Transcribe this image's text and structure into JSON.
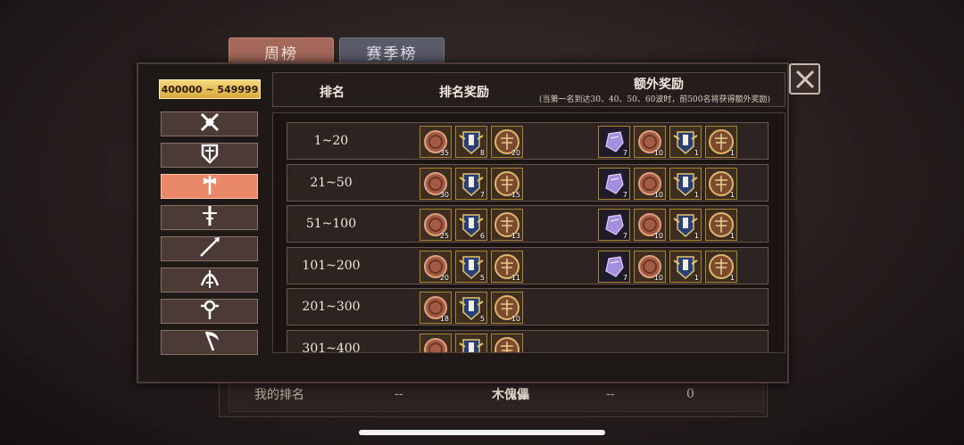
{
  "tabs": {
    "weekly": "周榜",
    "season": "赛季榜"
  },
  "score_range": "400000 ~ 549999",
  "weapons": [
    {
      "icon": "crossed-swords-icon",
      "active": false
    },
    {
      "icon": "shield-icon",
      "active": false
    },
    {
      "icon": "axe-icon",
      "active": true
    },
    {
      "icon": "greatsword-icon",
      "active": false
    },
    {
      "icon": "spear-icon",
      "active": false
    },
    {
      "icon": "bow-icon",
      "active": false
    },
    {
      "icon": "orb-staff-icon",
      "active": false
    },
    {
      "icon": "scythe-icon",
      "active": false
    }
  ],
  "header": {
    "rank": "排名",
    "rank_reward": "排名奖励",
    "extra_reward": "额外奖励",
    "extra_note": "(当第一名到达30、40、50、60波时，前500名将获得额外奖励)"
  },
  "rows": [
    {
      "rank": "1~20",
      "rewards": [
        35,
        8,
        20
      ],
      "extra": [
        7,
        10,
        1,
        1
      ]
    },
    {
      "rank": "21~50",
      "rewards": [
        30,
        7,
        15
      ],
      "extra": [
        7,
        10,
        1,
        1
      ]
    },
    {
      "rank": "51~100",
      "rewards": [
        25,
        6,
        13
      ],
      "extra": [
        7,
        10,
        1,
        1
      ]
    },
    {
      "rank": "101~200",
      "rewards": [
        20,
        5,
        11
      ],
      "extra": [
        7,
        10,
        1,
        1
      ]
    },
    {
      "rank": "201~300",
      "rewards": [
        18,
        5,
        10
      ],
      "extra": []
    },
    {
      "rank": "301~400",
      "rewards": [],
      "extra": []
    }
  ],
  "reward_icons": [
    "bronze-coin-icon",
    "crest-token-icon",
    "dragonfly-medal-icon"
  ],
  "extra_icons": [
    "purple-crystal-icon",
    "bronze-coin-icon",
    "crest-token-icon",
    "dragonfly-medal-icon"
  ],
  "footer": {
    "my_rank_label": "我的排名",
    "rank_value": "--",
    "name": "木傀儡",
    "wave": "--",
    "score": "0"
  },
  "colors": {
    "accent": "#e9896a",
    "gold": "#d9a93d",
    "panel": "#1e1817"
  }
}
